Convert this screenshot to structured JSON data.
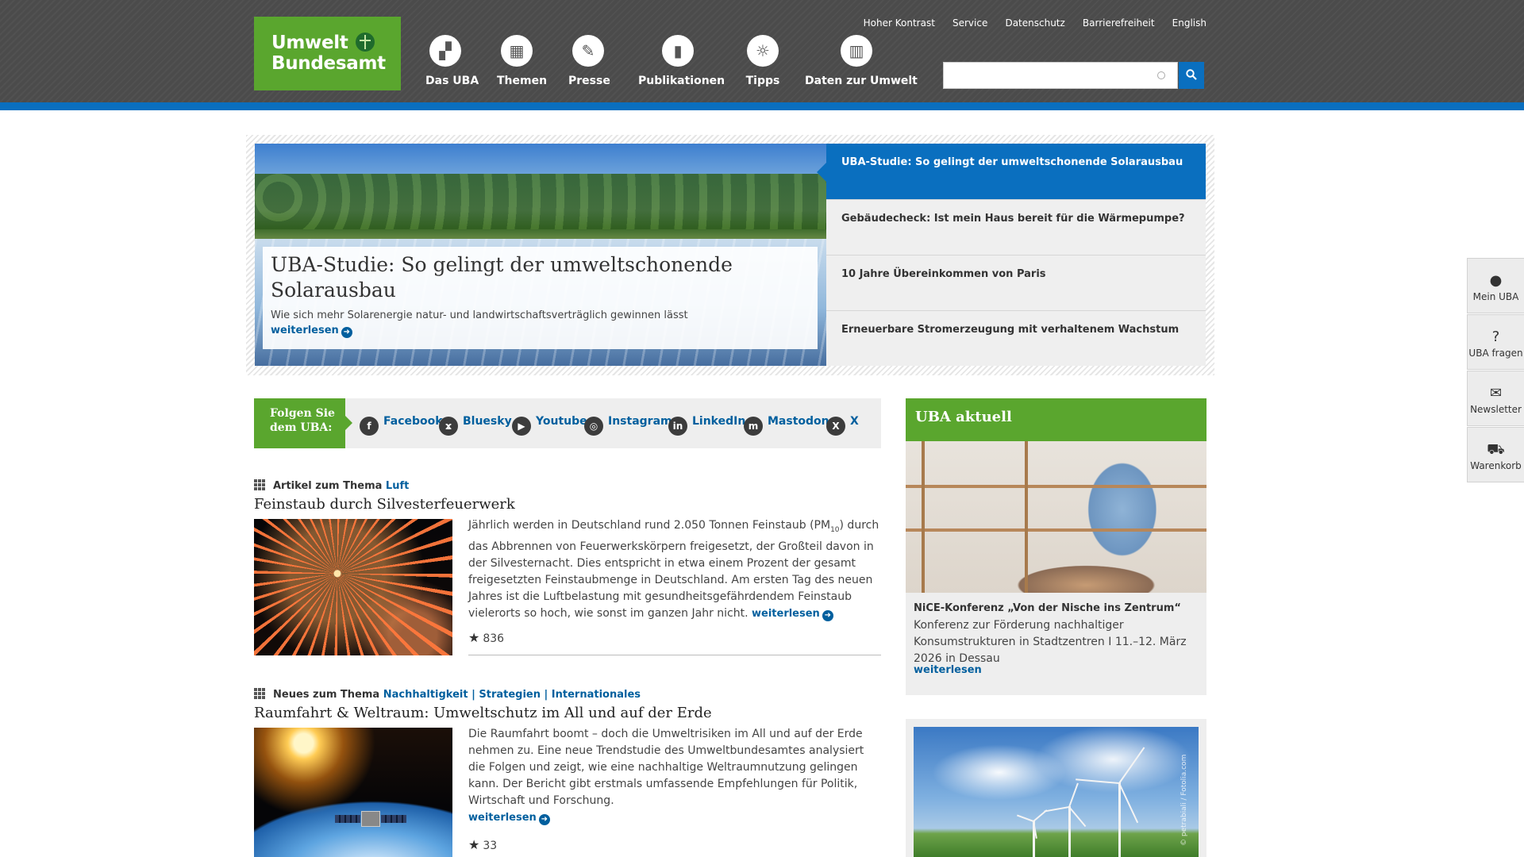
{
  "logo": {
    "line1": "Umwelt",
    "line2": "Bundesamt"
  },
  "mainnav": [
    {
      "label": "Das UBA",
      "icon": "building-icon",
      "glyph": "▞"
    },
    {
      "label": "Themen",
      "icon": "grid-icon",
      "glyph": "▦"
    },
    {
      "label": "Presse",
      "icon": "newspaper-icon",
      "glyph": "✎"
    },
    {
      "label": "Publikationen",
      "icon": "book-icon",
      "glyph": "▮"
    },
    {
      "label": "Tipps",
      "icon": "lightbulb-icon",
      "glyph": "☼"
    },
    {
      "label": "Daten zur Umwelt",
      "icon": "bar-chart-icon",
      "glyph": "▥"
    }
  ],
  "metanav": [
    "Hoher Kontrast",
    "Service",
    "Datenschutz",
    "Barrierefreiheit",
    "English"
  ],
  "search": {
    "placeholder": "",
    "value": ""
  },
  "slider": {
    "headline": "UBA-Studie: So gelingt der umweltschonende Solarausbau",
    "teaser": "Wie sich mehr Solarenergie natur- und landwirtschaftsverträglich gewinnen lässt",
    "more": "weiterlesen",
    "items": [
      "UBA-Studie: So gelingt der umweltschonende Solarausbau",
      "Gebäudecheck: Ist mein Haus bereit für die Wärmepumpe?",
      "10 Jahre Übereinkommen von Paris",
      "Erneuerbare Stromerzeugung mit verhaltenem Wachstum"
    ],
    "active_index": 0
  },
  "social": {
    "label": "Folgen Sie dem UBA:",
    "links": [
      {
        "label": "Facebook",
        "icon": "facebook-icon",
        "glyph": "f"
      },
      {
        "label": "Bluesky",
        "icon": "bluesky-icon",
        "glyph": "ϫ"
      },
      {
        "label": "Youtube",
        "icon": "youtube-icon",
        "glyph": "▶"
      },
      {
        "label": "Instagram",
        "icon": "instagram-icon",
        "glyph": "◎"
      },
      {
        "label": "LinkedIn",
        "icon": "linkedin-icon",
        "glyph": "in"
      },
      {
        "label": "Mastodon",
        "icon": "mastodon-icon",
        "glyph": "m"
      },
      {
        "label": "X",
        "icon": "x-icon",
        "glyph": "X"
      }
    ]
  },
  "articles": [
    {
      "kicker": "Artikel zum Thema",
      "topic": "Luft",
      "title": "Feinstaub durch Silvesterfeuerwerk",
      "text_before": "Jährlich werden in Deutschland rund 2.050 Tonnen Feinstaub (PM",
      "text_sub": "10",
      "text_after": ") durch das Abbrennen von Feuerwerkskörpern freigesetzt, der Großteil davon in der Silvesternacht. Dies entspricht in etwa einem Prozent der gesamt freigesetzten Feinstaubmenge in Deutschland. Am ersten Tag des neuen Jahres ist die Luftbelastung mit gesundheitsgefährdendem Feinstaub vielerorts so hoch, wie sonst im ganzen Jahr nicht.",
      "more": "weiterlesen",
      "rating": "836"
    },
    {
      "kicker": "Neues zum Thema",
      "topic": "Nachhaltigkeit | Strategien | Internationales",
      "title": "Raumfahrt & Weltraum: Umweltschutz im All und auf der Erde",
      "text": "Die Raumfahrt boomt – doch die Umweltrisiken im All und auf der Erde nehmen zu. Eine neue Trendstudie des Umweltbundesamtes analysiert die Folgen und zeigt, wie eine nachhaltige Weltraumnutzung gelingen kann. Der Bericht gibt erstmals umfassende Empfehlungen für Politik, Wirtschaft und Forschung.",
      "more": "weiterlesen",
      "rating": "33"
    }
  ],
  "news": {
    "heading": "UBA aktuell",
    "title": "NiCE-Konferenz „Von der Nische ins Zentrum“",
    "text": "Konferenz zur Förderung nachhaltiger Konsumstrukturen in Stadtzentren I 11.–12. März 2026 in Dessau",
    "more": "weiterlesen"
  },
  "wind_credit": "© petrabiali / Fotolia.com",
  "sidebar": [
    {
      "label": "Mein UBA",
      "icon": "user-icon",
      "glyph": "●"
    },
    {
      "label": "UBA fragen",
      "icon": "question-icon",
      "glyph": "?"
    },
    {
      "label": "Newsletter",
      "icon": "envelope-icon",
      "glyph": "✉"
    },
    {
      "label": "Warenkorb",
      "icon": "cart-icon",
      "glyph": "⛟"
    }
  ],
  "colors": {
    "green": "#5aa62e",
    "blue": "#0a6fbf",
    "header": "#4b4b4b",
    "link": "#005f9e"
  }
}
